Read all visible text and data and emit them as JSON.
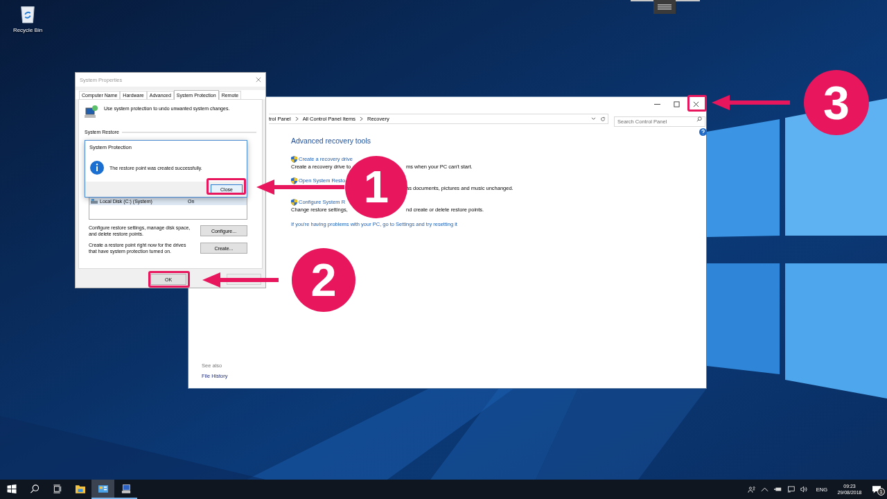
{
  "desktop": {
    "icons": [
      {
        "label": "Recycle Bin"
      }
    ]
  },
  "control_panel": {
    "breadcrumb": [
      "trol Panel",
      "All Control Panel Items",
      "Recovery"
    ],
    "search": {
      "placeholder": "Search Control Panel"
    },
    "heading": "Advanced recovery tools",
    "tools": [
      {
        "link": "Create a recovery drive",
        "description_before": "Create a recovery drive to",
        "description_after": "ms when your PC can't start."
      },
      {
        "link": "Open System Resto",
        "description_after": "as documents, pictures and music unchanged."
      },
      {
        "link": "Configure System R",
        "description_before": "Change restore settings,",
        "description_after": "nd create or delete restore points."
      }
    ],
    "reset_link": "If you're having problems with your PC, go to Settings and try resetting it",
    "see_also": {
      "title": "See also",
      "links": [
        "File History"
      ]
    }
  },
  "system_properties": {
    "title": "System Properties",
    "tabs": [
      {
        "label": "Computer Name",
        "selected": false
      },
      {
        "label": "Hardware",
        "selected": false
      },
      {
        "label": "Advanced",
        "selected": false
      },
      {
        "label": "System Protection",
        "selected": true
      },
      {
        "label": "Remote",
        "selected": false
      }
    ],
    "intro": "Use system protection to undo unwanted system changes.",
    "group_label": "System Restore",
    "drives": [
      {
        "name": "Local Disk (C:) (System)",
        "protection": "On",
        "selected": true
      }
    ],
    "configure_text": "Configure restore settings, manage disk space, and delete restore points.",
    "configure_button": "Configure...",
    "create_text": "Create a restore point right now for the drives that have system protection turned on.",
    "create_button": "Create...",
    "ok_button": "OK"
  },
  "message_box": {
    "title": "System Protection",
    "message": "The restore point was created successfully.",
    "button": "Close"
  },
  "annotations": [
    {
      "number": "1"
    },
    {
      "number": "2"
    },
    {
      "number": "3"
    }
  ],
  "taskbar": {
    "apps": [
      {
        "kind": "explorer",
        "active": false,
        "running": false
      },
      {
        "kind": "control-panel",
        "active": true,
        "running": true
      },
      {
        "kind": "system",
        "active": false,
        "running": true
      }
    ],
    "language": "ENG",
    "time": "09:23",
    "date": "29/08/2018",
    "notification_count": "1"
  }
}
